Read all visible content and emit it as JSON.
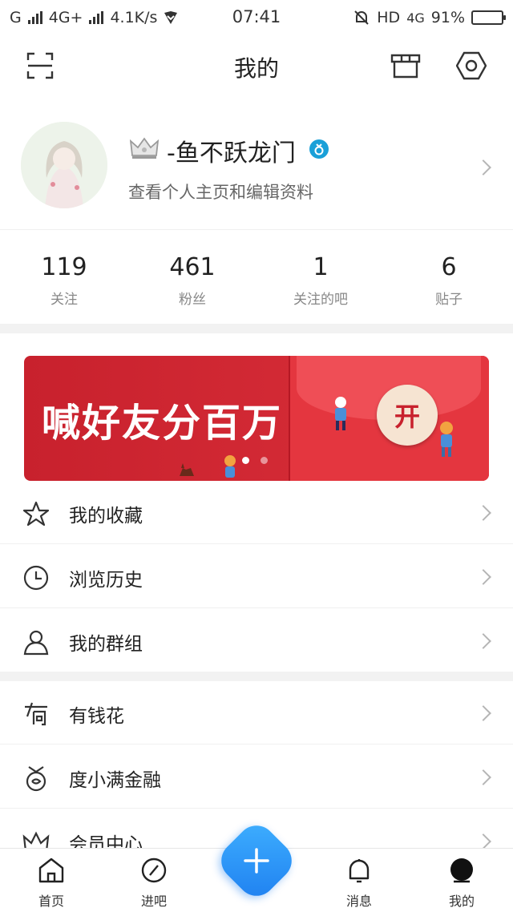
{
  "status_bar": {
    "carrier": "G",
    "network": "4G+",
    "speed": "4.1K/s",
    "time": "07:41",
    "hd": "HD",
    "network2": "4G",
    "battery_pct": "91%",
    "battery_level": 0.91
  },
  "header": {
    "title": "我的",
    "scan_icon": "scan-icon",
    "store_icon": "store-icon",
    "settings_icon": "settings-hexagon-icon"
  },
  "profile": {
    "username": "-鱼不跃龙门",
    "subtitle": "查看个人主页和编辑资料"
  },
  "stats": [
    {
      "value": "119",
      "label": "关注"
    },
    {
      "value": "461",
      "label": "粉丝"
    },
    {
      "value": "1",
      "label": "关注的吧"
    },
    {
      "value": "6",
      "label": "贴子"
    }
  ],
  "banner": {
    "headline": "喊好友分百万",
    "button_label": "开"
  },
  "menu_group1": [
    {
      "label": "我的收藏",
      "icon": "star-icon"
    },
    {
      "label": "浏览历史",
      "icon": "clock-icon"
    },
    {
      "label": "我的群组",
      "icon": "person-icon"
    }
  ],
  "menu_group2": [
    {
      "label": "有钱花",
      "icon": "youqianhua-icon"
    },
    {
      "label": "度小满金融",
      "icon": "duxiaoman-icon"
    },
    {
      "label": "会员中心",
      "icon": "crown-icon"
    }
  ],
  "tabs": [
    {
      "label": "首页",
      "icon": "home-icon"
    },
    {
      "label": "进吧",
      "icon": "compass-icon"
    },
    {
      "label": "消息",
      "icon": "bell-icon"
    },
    {
      "label": "我的",
      "icon": "profile-icon"
    }
  ],
  "colors": {
    "accent": "#1e7ff0",
    "banner_red": "#c8212d"
  }
}
